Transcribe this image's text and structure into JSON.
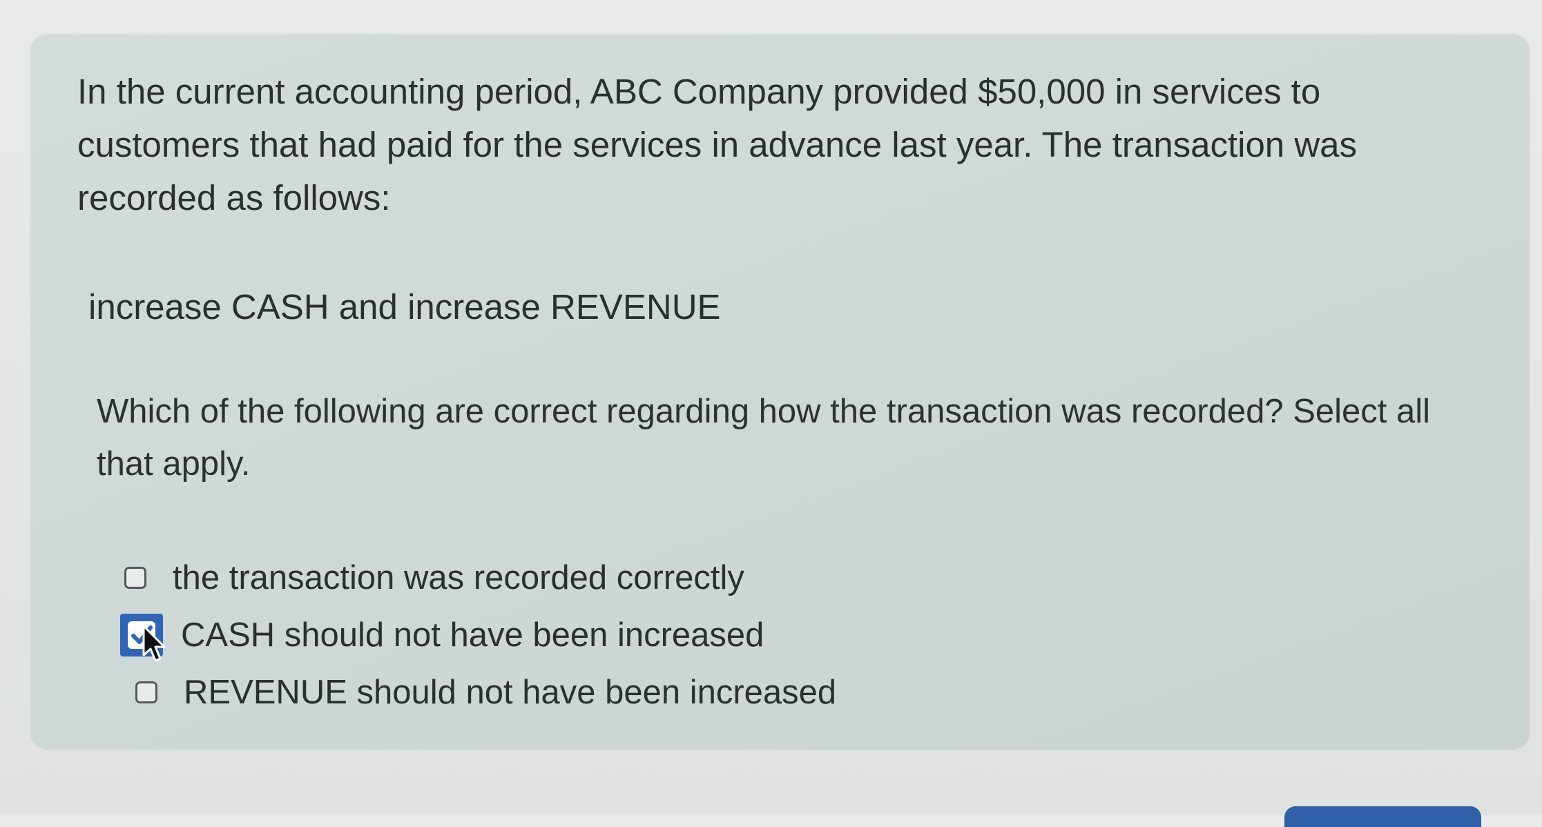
{
  "question": {
    "prompt": "In the current accounting period, ABC Company provided $50,000 in services to customers that had paid for the services in advance last year. The transaction was recorded as follows:",
    "entry": "increase CASH and increase REVENUE",
    "instruction": "Which of the following are correct regarding how the transaction was recorded? Select all that apply.",
    "options": [
      {
        "label": "the transaction was recorded correctly",
        "checked": false
      },
      {
        "label": "CASH should not have been increased",
        "checked": true
      },
      {
        "label": "REVENUE should not have been increased",
        "checked": false
      }
    ]
  },
  "colors": {
    "panel_background": "#cfd9d7",
    "checkbox_checked": "#2f64b7",
    "text": "#2b2f30",
    "bottom_button": "#2f5fa7"
  },
  "icons": {
    "checked_checkbox": "check-icon",
    "cursor": "mouse-pointer-icon"
  }
}
